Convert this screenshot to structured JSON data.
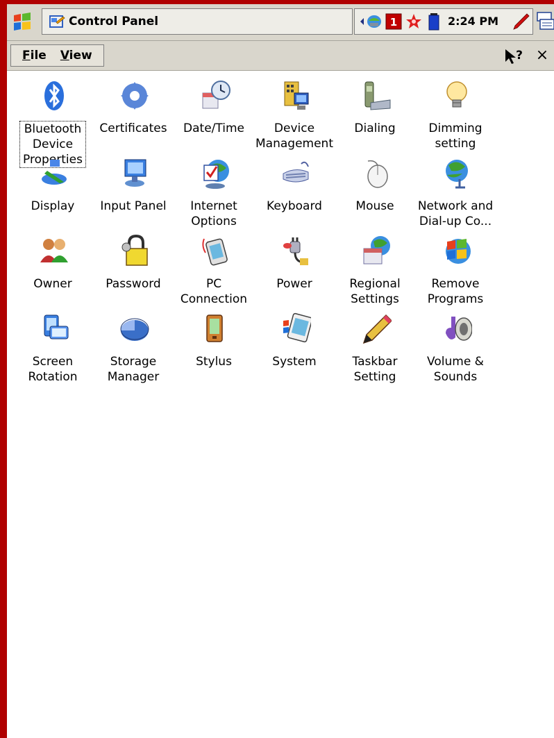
{
  "taskbar": {
    "title": "Control Panel",
    "time": "2:24 PM"
  },
  "menu": {
    "file": "File",
    "file_hotkey": "F",
    "file_rest": "ile",
    "view": "View",
    "view_hotkey": "V",
    "view_rest": "iew",
    "close": "×"
  },
  "items": [
    {
      "label_lines": [
        "Bluetooth",
        "Device",
        "Properties"
      ],
      "icon": "bluetooth-icon",
      "selected": true
    },
    {
      "label_lines": [
        "Certificates"
      ],
      "icon": "certificates-icon"
    },
    {
      "label_lines": [
        "Date/Time"
      ],
      "icon": "clock-icon"
    },
    {
      "label_lines": [
        "Device",
        "Management"
      ],
      "icon": "device-management-icon"
    },
    {
      "label_lines": [
        "Dialing"
      ],
      "icon": "phone-icon"
    },
    {
      "label_lines": [
        "Dimming",
        "setting"
      ],
      "icon": "lightbulb-icon"
    },
    {
      "label_lines": [
        "Display"
      ],
      "icon": "display-icon"
    },
    {
      "label_lines": [
        "Input Panel"
      ],
      "icon": "input-panel-icon"
    },
    {
      "label_lines": [
        "Internet",
        "Options"
      ],
      "icon": "globe-check-icon"
    },
    {
      "label_lines": [
        "Keyboard"
      ],
      "icon": "keyboard-icon"
    },
    {
      "label_lines": [
        "Mouse"
      ],
      "icon": "mouse-icon"
    },
    {
      "label_lines": [
        "Network and",
        "Dial-up Co..."
      ],
      "icon": "network-globe-icon"
    },
    {
      "label_lines": [
        "Owner"
      ],
      "icon": "owner-icon"
    },
    {
      "label_lines": [
        "Password"
      ],
      "icon": "padlock-icon"
    },
    {
      "label_lines": [
        "PC",
        "Connection"
      ],
      "icon": "pc-connection-icon"
    },
    {
      "label_lines": [
        "Power"
      ],
      "icon": "power-plug-icon"
    },
    {
      "label_lines": [
        "Regional",
        "Settings"
      ],
      "icon": "regional-globe-icon"
    },
    {
      "label_lines": [
        "Remove",
        "Programs"
      ],
      "icon": "remove-programs-icon"
    },
    {
      "label_lines": [
        "Screen",
        "Rotation"
      ],
      "icon": "screen-rotation-icon"
    },
    {
      "label_lines": [
        "Storage",
        "Manager"
      ],
      "icon": "pie-chart-icon"
    },
    {
      "label_lines": [
        "Stylus"
      ],
      "icon": "stylus-icon"
    },
    {
      "label_lines": [
        "System"
      ],
      "icon": "system-icon"
    },
    {
      "label_lines": [
        "Taskbar",
        "Setting"
      ],
      "icon": "pencil-icon"
    },
    {
      "label_lines": [
        "Volume &",
        "Sounds"
      ],
      "icon": "speaker-icon"
    }
  ]
}
